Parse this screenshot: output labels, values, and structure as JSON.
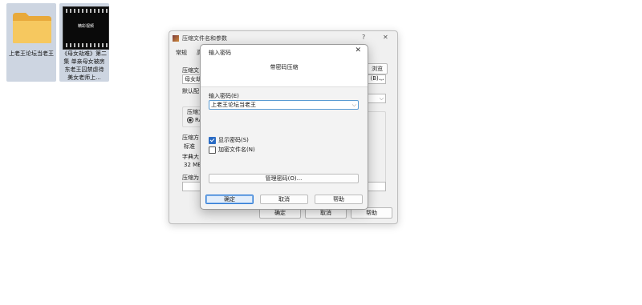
{
  "desktop": {
    "items": [
      {
        "label": "上老王论坛当老王",
        "icon": "folder-icon"
      },
      {
        "label": "《母女劫难》第二集 单亲母女被房东老王囚禁虐待 美女老师上...",
        "icon": "video-icon",
        "thumb_text": "精彩视频"
      }
    ]
  },
  "back_window": {
    "title": "压缩文件名和参数",
    "help": "?",
    "close": "✕",
    "tabs": [
      "常规",
      "高"
    ],
    "fields": {
      "archive_name_label": "压缩文",
      "archive_name_value": "母女劫",
      "browse_label": "浏览(B)...",
      "default_profile_label": "默认配",
      "format_label": "压缩文",
      "format_option": "RA",
      "method_label": "压缩方",
      "method_value": "标准",
      "dict_label": "字典大",
      "dict_value": "32 MB",
      "split_label": "压缩为"
    },
    "buttons": {
      "ok": "确定",
      "cancel": "取消",
      "help": "帮助"
    }
  },
  "dialog": {
    "title": "输入密码",
    "close": "✕",
    "heading": "带密码压缩",
    "password_label": "输入密码(E)",
    "password_value": "上老王论坛当老王",
    "show_password_label": "显示密码(S)",
    "show_password_checked": true,
    "encrypt_names_label": "加密文件名(N)",
    "encrypt_names_checked": false,
    "manage_button": "管理密码(O)...",
    "buttons": {
      "ok": "确定",
      "cancel": "取消",
      "help": "帮助"
    }
  }
}
